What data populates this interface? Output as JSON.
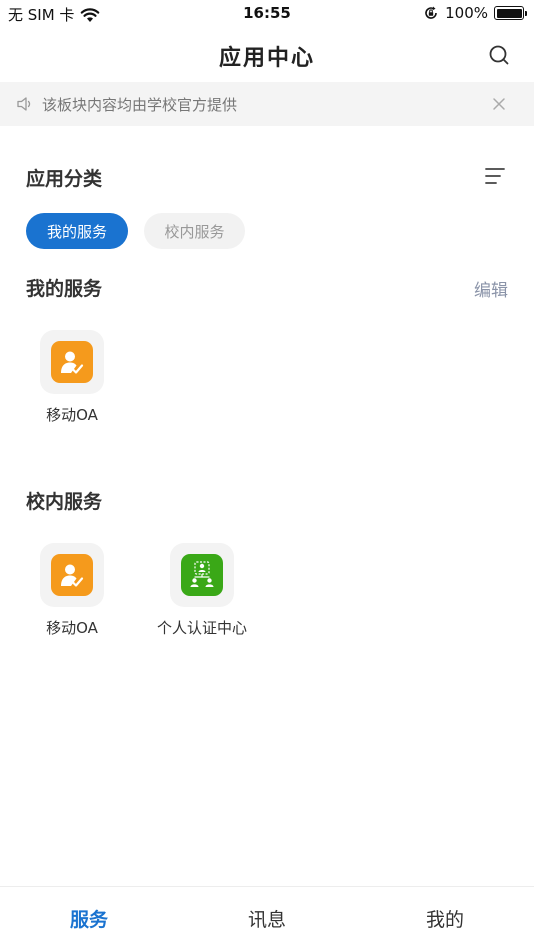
{
  "status": {
    "carrier": "无 SIM 卡",
    "time": "16:55",
    "battery": "100%",
    "battery_level": 1.0
  },
  "nav": {
    "title": "应用中心",
    "search_icon": "search-icon"
  },
  "notice": {
    "text": "该板块内容均由学校官方提供",
    "icon": "speaker-icon",
    "close_icon": "close-icon"
  },
  "category": {
    "title": "应用分类",
    "sort_icon": "sort-list-icon",
    "chips": [
      {
        "label": "我的服务",
        "active": true
      },
      {
        "label": "校内服务",
        "active": false
      }
    ]
  },
  "my_services": {
    "title": "我的服务",
    "edit_label": "编辑",
    "apps": [
      {
        "label": "移动OA",
        "icon": "person-check-icon",
        "color": "#f59a1c"
      }
    ]
  },
  "campus_services": {
    "title": "校内服务",
    "apps": [
      {
        "label": "移动OA",
        "icon": "person-check-icon",
        "color": "#f59a1c"
      },
      {
        "label": "个人认证中心",
        "icon": "org-chart-icon",
        "color": "#3aa817"
      }
    ]
  },
  "tabs": [
    {
      "label": "服务",
      "active": true
    },
    {
      "label": "讯息",
      "active": false
    },
    {
      "label": "我的",
      "active": false
    }
  ],
  "colors": {
    "accent": "#1a73d0",
    "notice_bg": "#f4f4f4",
    "edit_link": "#8a93a8"
  }
}
